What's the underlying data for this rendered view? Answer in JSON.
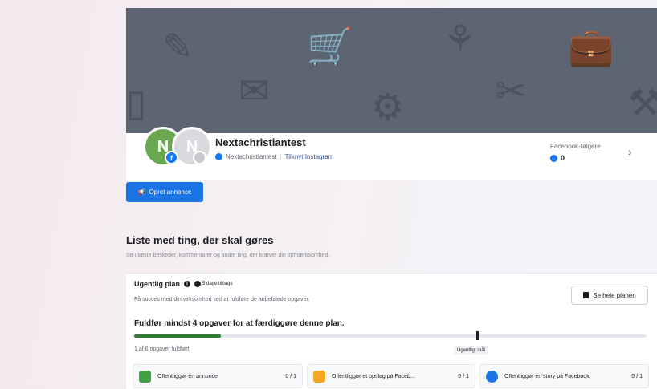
{
  "colors": {
    "cover": "#5d6472",
    "primary_button": "#1b74e4",
    "progress": "#2e7d32"
  },
  "page": {
    "name": "Nextachristiantest",
    "avatar_initial": "N",
    "facebook_handle": "Nextachristiantest",
    "separator": "|",
    "connect_instagram": "Tilknyt Instagram",
    "followers_label": "Facebook-følgere",
    "followers_count": "0",
    "chevron": "›"
  },
  "actions": {
    "create_ad": "Opret annonce"
  },
  "todo": {
    "title": "Liste med ting, der skal gøres",
    "subtitle": "Se ulæste beskeder, kommentarer og andre ting, der kræver din opmærksomhed."
  },
  "plan": {
    "title": "Ugentlig plan",
    "days_left": "5 dage tilbage",
    "description": "Få succes med din virksomhed ved at fuldføre de anbefalede opgaver.",
    "see_plan_button": "Se hele planen",
    "goal_text": "Fuldfør mindst 4 opgaver for at færdiggøre denne plan.",
    "progress_fraction": 0.17,
    "completed_text": "1 af 6 opgaver fuldført",
    "weekly_goal_label": "Ugentligt mål",
    "tasks": [
      {
        "label": "Offentliggør én annonce",
        "count": "0 / 1",
        "icon": "ad-icon",
        "color": "#43a047"
      },
      {
        "label": "Offentliggør et opslag på Faceb...",
        "count": "0 / 1",
        "icon": "post-icon",
        "color": "#f5a623"
      },
      {
        "label": "Offentliggør en story på Facebook",
        "count": "0 / 1",
        "icon": "story-icon",
        "color": "#1b74e4"
      }
    ]
  }
}
